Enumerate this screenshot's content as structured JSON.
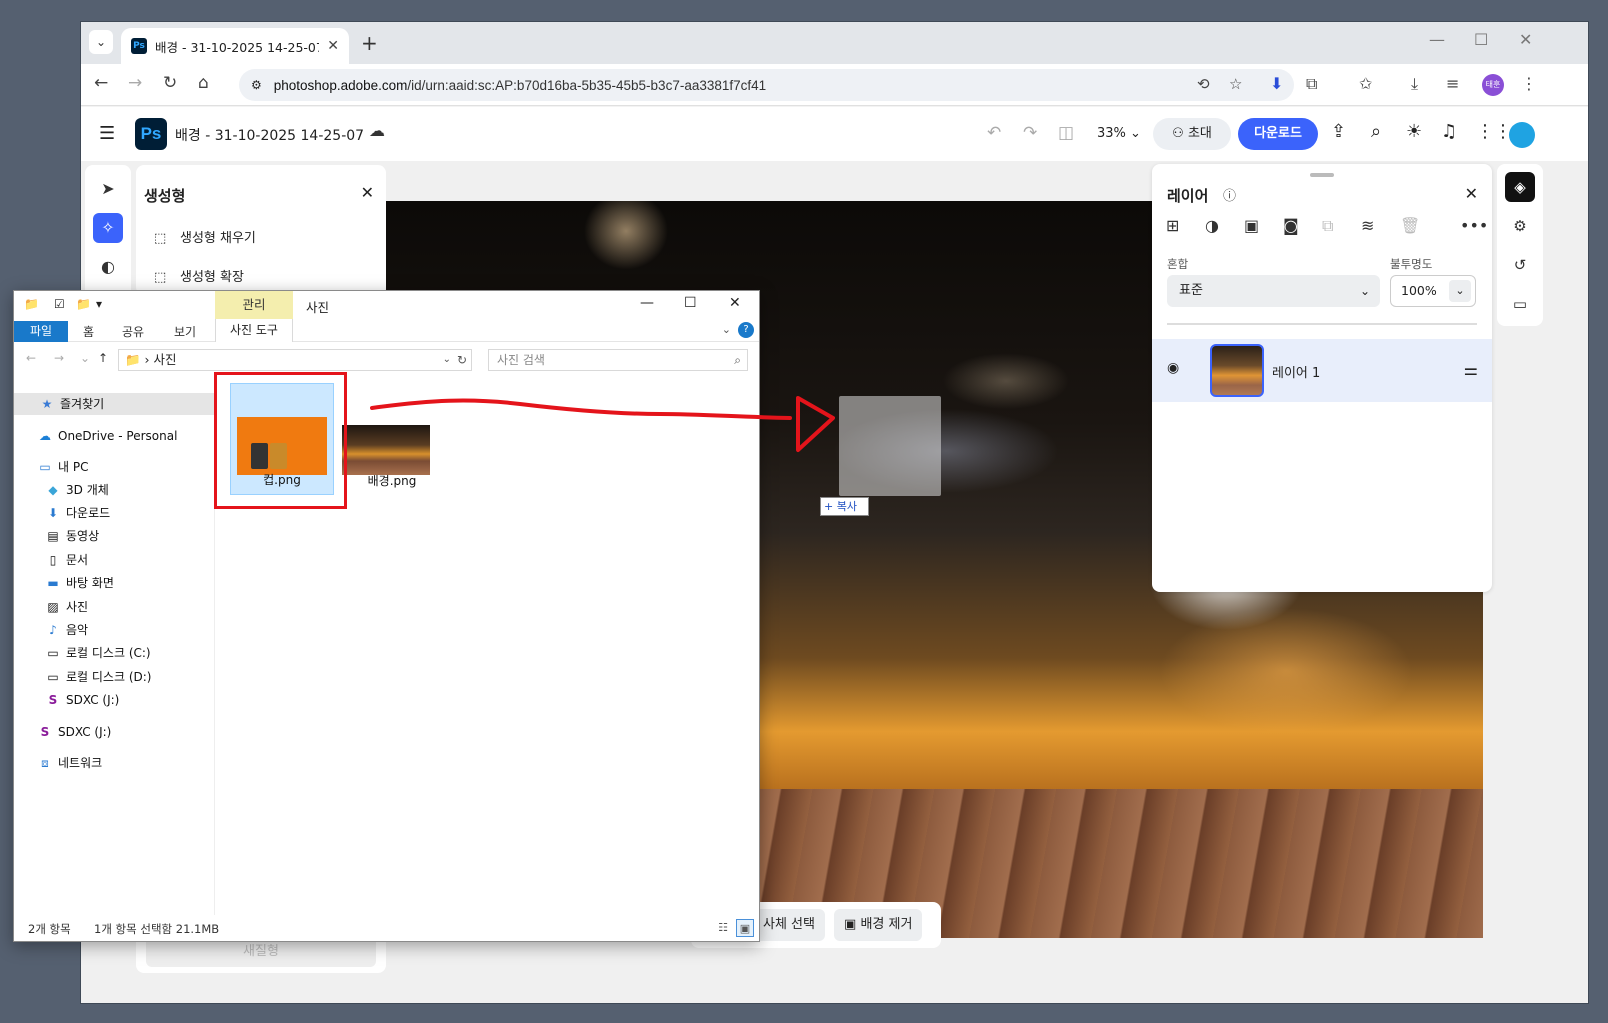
{
  "browser": {
    "tab_title": "배경 - 31-10-2025 14-25-07 -",
    "tab_favicon": "Ps",
    "url_host": "photoshop.adobe.com",
    "url_path": "/id/urn:aaid:sc:AP:b70d16ba-5b35-45b5-b3c7-aa3381f7cf41",
    "avatar_text": "태훈"
  },
  "ps": {
    "logo": "Ps",
    "doc_title": "배경 - 31-10-2025 14-25-07",
    "zoom": "33%",
    "invite_label": "초대",
    "download_label": "다운로드",
    "accent": "#3b63fb"
  },
  "gen_panel": {
    "title": "생성형",
    "items": [
      {
        "label": "생성형 채우기",
        "icon": "generative-fill-icon"
      },
      {
        "label": "생성형 확장",
        "icon": "generative-expand-icon"
      }
    ],
    "bottom_ghost": "새질형"
  },
  "canvas_tools": {
    "select_subject": "사체 선택",
    "remove_bg": "배경 제거"
  },
  "drag": {
    "copy_tip": "+ 복사"
  },
  "layers": {
    "title": "레이어",
    "blend_label": "혼합",
    "blend_value": "표준",
    "opacity_label": "불투명도",
    "opacity_value": "100%",
    "layer_name": "레이어 1"
  },
  "explorer": {
    "manage_tab": "관리",
    "window_title": "사진",
    "ribbon": {
      "file": "파일",
      "home": "홈",
      "share": "공유",
      "view": "보기",
      "tools": "사진 도구"
    },
    "path": "사진",
    "search_placeholder": "사진 검색",
    "sidebar": [
      {
        "label": "즐겨찾기",
        "icon": "star-icon"
      },
      {
        "label": "OneDrive - Personal",
        "icon": "onedrive-icon"
      },
      {
        "label": "내 PC",
        "icon": "pc-icon"
      },
      {
        "label": "3D 개체",
        "icon": "3d-objects-icon"
      },
      {
        "label": "다운로드",
        "icon": "download-arrow-icon"
      },
      {
        "label": "동영상",
        "icon": "video-icon"
      },
      {
        "label": "문서",
        "icon": "document-icon"
      },
      {
        "label": "바탕 화면",
        "icon": "desktop-icon"
      },
      {
        "label": "사진",
        "icon": "pictures-icon"
      },
      {
        "label": "음악",
        "icon": "music-icon"
      },
      {
        "label": "로컬 디스크 (C:)",
        "icon": "disk-icon"
      },
      {
        "label": "로컬 디스크 (D:)",
        "icon": "disk-icon"
      },
      {
        "label": "SDXC (J:)",
        "icon": "sdcard-icon"
      },
      {
        "label": "SDXC (J:)",
        "icon": "sdcard-icon"
      },
      {
        "label": "네트워크",
        "icon": "network-icon"
      }
    ],
    "files": [
      {
        "name": "컵.png"
      },
      {
        "name": "배경.png"
      }
    ],
    "status_count": "2개 항목",
    "status_selected": "1개 항목 선택함 21.1MB"
  }
}
